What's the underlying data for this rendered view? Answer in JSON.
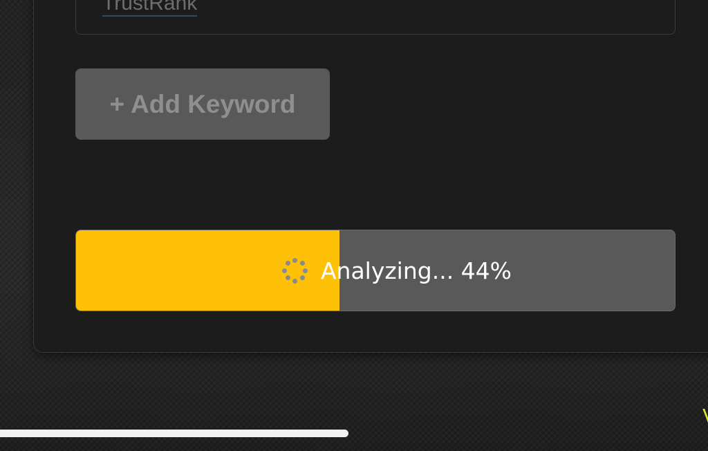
{
  "keyword_field": {
    "value": "TrustRank"
  },
  "add_keyword_button": {
    "label": "+ Add Keyword"
  },
  "progress": {
    "label": "Analyzing... 44%",
    "percent": 44,
    "fill_color": "#fec107",
    "track_color": "#595959",
    "spinner_icon": "loading-spinner-icon"
  },
  "edge_glyph": "V",
  "colors": {
    "panel_background": "#1c1c1c",
    "page_background": "#262626",
    "button_background": "#595959",
    "accent": "#fec107"
  }
}
